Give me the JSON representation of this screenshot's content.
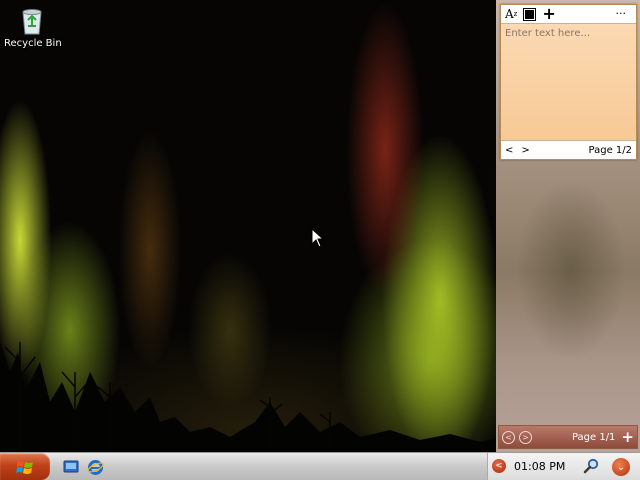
{
  "desktop": {
    "icons": [
      {
        "label": "Recycle Bin",
        "icon": "recycle-bin-icon"
      }
    ]
  },
  "notes_gadget": {
    "toolbar": {
      "font_icon": "font-style-icon",
      "font_text": "A",
      "font_sub": "z",
      "color_icon": "color-swatch-icon",
      "add_label": "+",
      "more_label": "···"
    },
    "placeholder": "Enter text here...",
    "prev_label": "<",
    "next_label": ">",
    "page_label": "Page 1/2"
  },
  "sidebar_controls": {
    "prev_icon": "circle-left-icon",
    "next_icon": "circle-right-icon",
    "page_label": "Page 1/1",
    "add_label": "+"
  },
  "taskbar": {
    "start_icon": "windows-logo-icon",
    "quick_launch": [
      "show-desktop-icon",
      "internet-explorer-icon"
    ],
    "tray_arrow_icon": "chevron-left-icon",
    "clock": "01:08 PM",
    "search_icon": "search-icon",
    "menu_icon": "chevron-down-icon"
  },
  "colors": {
    "accent": "#c0421a",
    "note": "#f7c995",
    "sidebar_bar": "#8d4b3a"
  }
}
